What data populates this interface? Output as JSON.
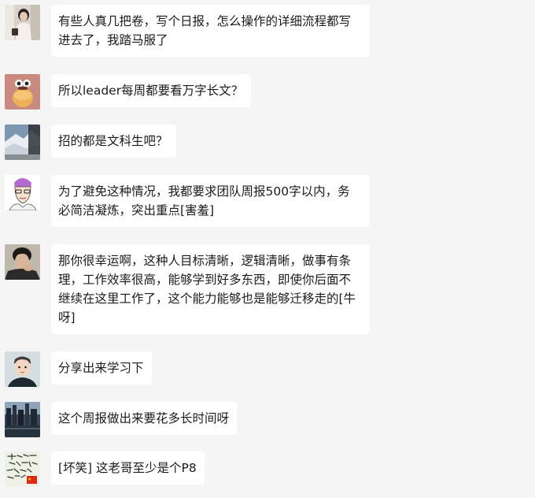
{
  "messages": [
    {
      "avatar": "avatar-woman-portrait",
      "text": "有些人真几把卷，写个日报，怎么操作的详细流程都写进去了，我踏马服了"
    },
    {
      "avatar": "avatar-cartoon-character",
      "text": "所以leader每周都要看万字长文？"
    },
    {
      "avatar": "avatar-mountain-photo",
      "text": "招的都是文科生吧？"
    },
    {
      "avatar": "avatar-cartoon-face",
      "text": "为了避免这种情况，我都要求团队周报500字以内，务必简洁凝炼，突出重点[害羞]"
    },
    {
      "avatar": "avatar-person-photo",
      "text": "那你很幸运啊，这种人目标清晰，逻辑清晰，做事有条理，工作效率很高，能够学到好多东西，即使你后面不继续在这里工作了，这个能力能够也是能够迁移走的[牛呀]"
    },
    {
      "avatar": "avatar-cartoon-man",
      "text": "分享出来学习下"
    },
    {
      "avatar": "avatar-city-night-photo",
      "text": "这个周报做出来要花多长时间呀"
    },
    {
      "avatar": "avatar-calligraphy-image",
      "text": "[坏笑] 这老哥至少是个P8"
    }
  ],
  "colors": {
    "background": "#f5f5f5",
    "bubble": "#ffffff",
    "text": "#1b1b1b"
  }
}
